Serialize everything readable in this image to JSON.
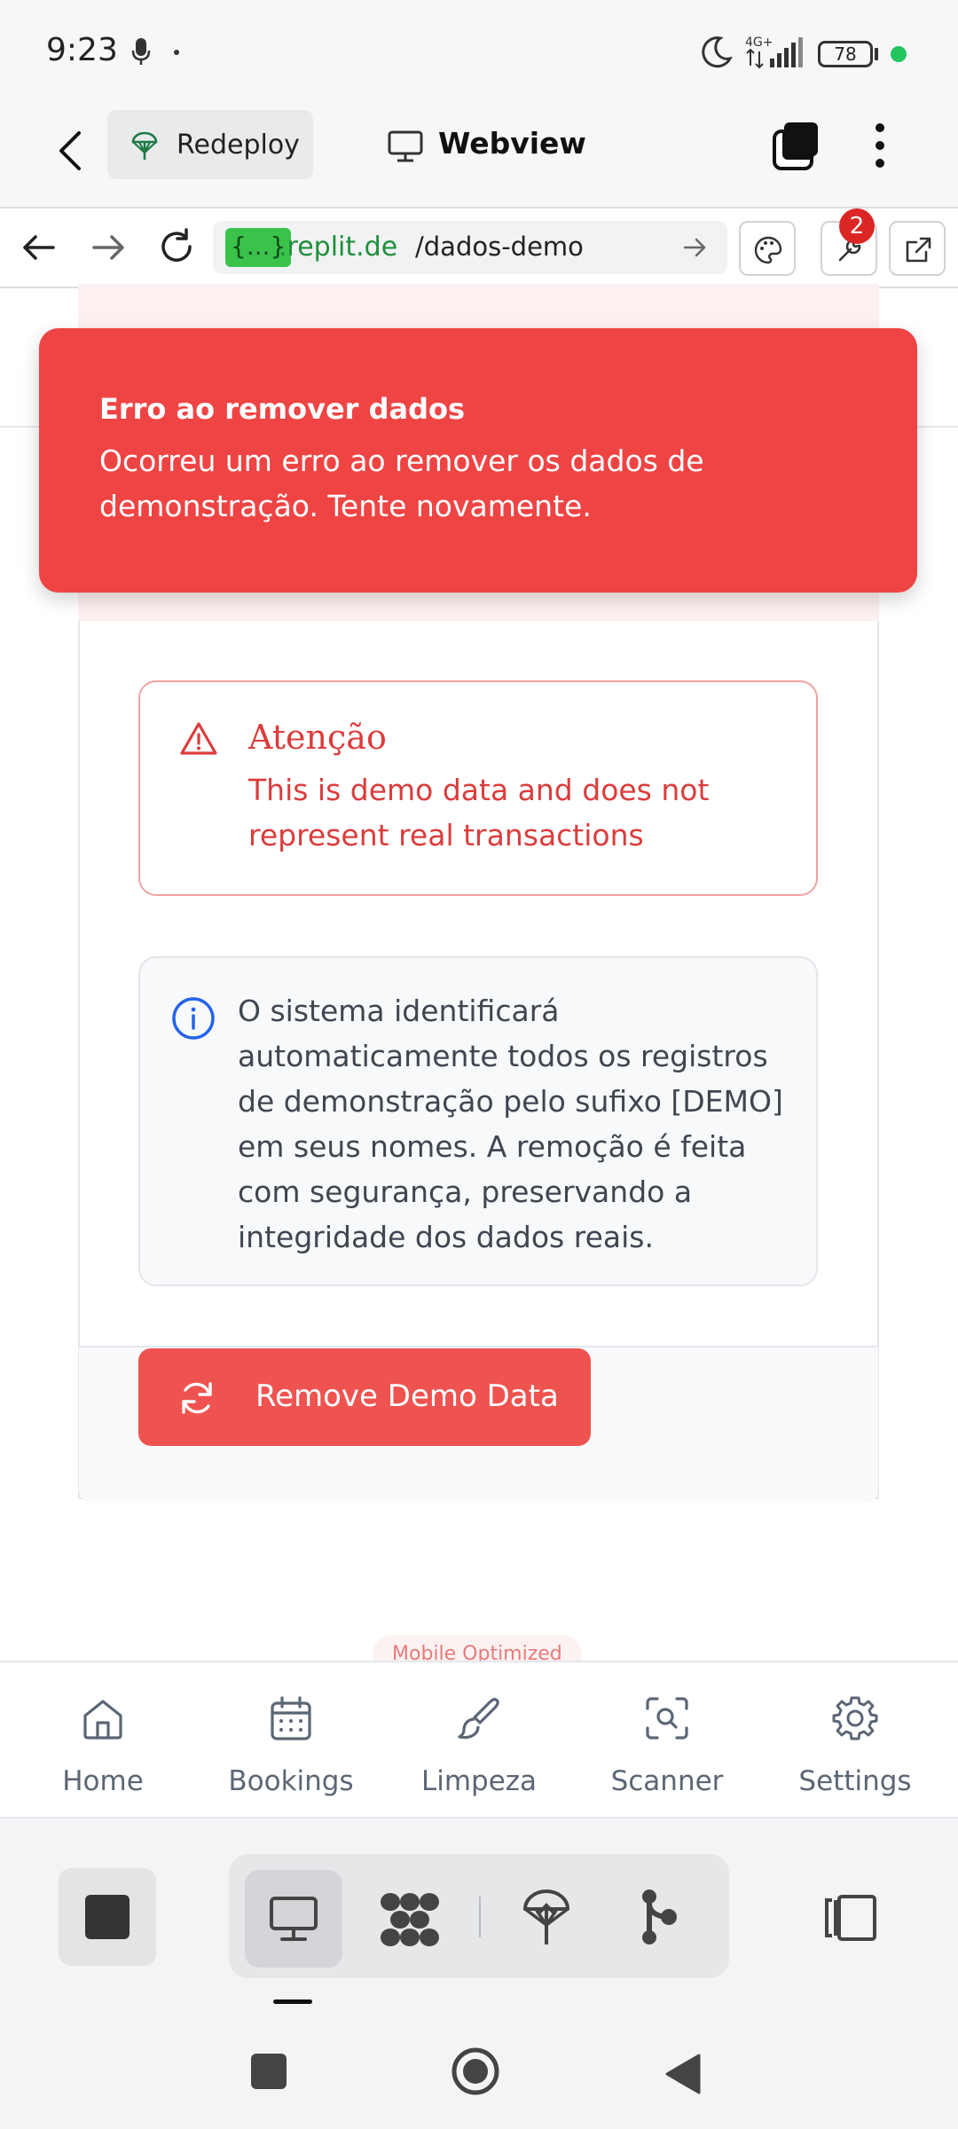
{
  "status_bar": {
    "time": "9:23",
    "network": "4G+",
    "battery": "78"
  },
  "app_header": {
    "redeploy_label": "Redeploy",
    "webview_label": "Webview"
  },
  "browser": {
    "url_badge": "{...}",
    "url_host": ".replit.de",
    "url_path": "/dados-demo",
    "devtools_badge": "2"
  },
  "toast": {
    "title": "Erro ao remover dados",
    "message": "Ocorreu um erro ao remover os dados de demonstração. Tente novamente."
  },
  "warning": {
    "title": "Atenção",
    "message": "This is demo data and does not represent real transactions"
  },
  "info": {
    "message": "O sistema identificará automaticamente todos os registros de demonstração pelo sufixo [DEMO] em seus nomes. A remoção é feita com segurança, preservando a integridade dos dados reais."
  },
  "remove_button": {
    "label": "Remove Demo Data"
  },
  "mobile_badge": "Mobile Optimized",
  "bottom_nav": {
    "items": [
      {
        "label": "Home",
        "icon": "home-icon"
      },
      {
        "label": "Bookings",
        "icon": "calendar-icon"
      },
      {
        "label": "Limpeza",
        "icon": "brush-icon"
      },
      {
        "label": "Scanner",
        "icon": "scan-icon"
      },
      {
        "label": "Settings",
        "icon": "gear-icon"
      }
    ]
  },
  "colors": {
    "toast_bg": "#ef4444",
    "warning_text": "#dc3c3c",
    "info_icon": "#2563eb",
    "button_bg": "#ef5350",
    "nav_icon": "#5b6675"
  }
}
